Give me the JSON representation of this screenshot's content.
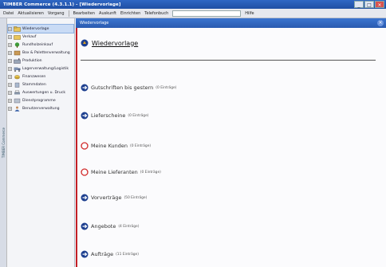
{
  "window": {
    "title": "TIMBER Commerce (4.3.1.1) - [Wiedervorlage]",
    "controls": [
      "_",
      "□",
      "×"
    ]
  },
  "menubar": {
    "items": [
      "Datei",
      "Aktualisieren",
      "Vorgang",
      "Bearbeiten",
      "Auskunft",
      "Einrichten",
      "Telefonbuch"
    ],
    "help": "Hilfe"
  },
  "sidebar": {
    "strip_text": "TIMBER Commerce",
    "items": [
      {
        "label": "Wiedervorlage",
        "active": true
      },
      {
        "label": "Verkauf",
        "active": false
      },
      {
        "label": "Rundholzeinkauf",
        "active": false
      },
      {
        "label": "Box & Palettenverwaltung",
        "active": false
      },
      {
        "label": "Produktion",
        "active": false
      },
      {
        "label": "Lagerverwaltung/Logistik",
        "active": false
      },
      {
        "label": "Finanzwesen",
        "active": false
      },
      {
        "label": "Stammdaten",
        "active": false
      },
      {
        "label": "Auswertungen u. Druck",
        "active": false
      },
      {
        "label": "Dienstprogramme",
        "active": false
      },
      {
        "label": "Benutzerverwaltung",
        "active": false
      }
    ]
  },
  "main": {
    "tab_title": "Wiedervorlage",
    "page_title": "Wiedervorlage",
    "colors": {
      "accent_red": "#c31e25",
      "header_blue": "#2f67c4",
      "circle_red": "#d22a2a",
      "icon_blue": "#1d3f8f"
    },
    "rows": [
      {
        "label": "Gutschriften bis gestern",
        "count": "(0 Einträge)",
        "icon": "arrow-circle-icon"
      },
      {
        "label": "Lieferscheine",
        "count": "(0 Einträge)",
        "icon": "arrow-circle-icon"
      },
      {
        "label": "Meine Kunden",
        "count": "(0 Einträge)",
        "icon": "red-circle-icon"
      },
      {
        "label": "Meine Lieferanten",
        "count": "(0 Einträge)",
        "icon": "red-circle-icon"
      },
      {
        "label": "Vorverträge",
        "count": "(50 Einträge)",
        "icon": "arrow-circle-icon"
      },
      {
        "label": "Angebote",
        "count": "(4 Einträge)",
        "icon": "arrow-circle-icon"
      },
      {
        "label": "Aufträge",
        "count": "(11 Einträge)",
        "icon": "arrow-circle-icon"
      }
    ]
  }
}
